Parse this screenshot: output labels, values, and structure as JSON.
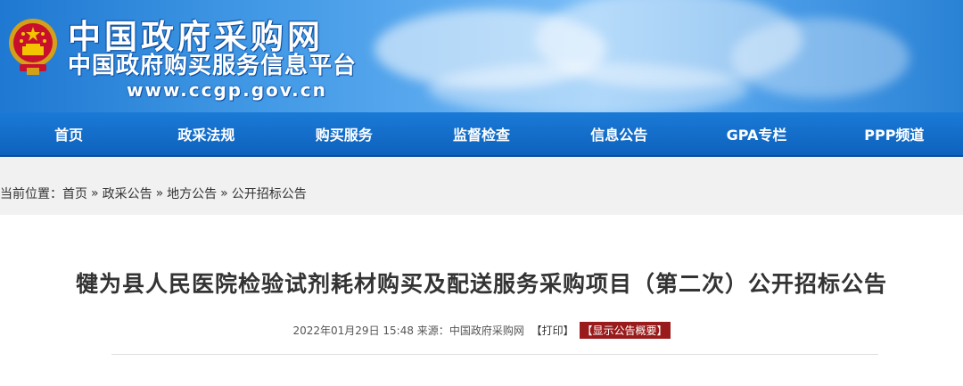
{
  "header": {
    "title": "中国政府采购网",
    "subtitle": "中国政府购买服务信息平台",
    "url": "www.ccgp.gov.cn",
    "emblem_icon": "national-emblem-icon"
  },
  "nav": {
    "items": [
      {
        "label": "首页"
      },
      {
        "label": "政采法规"
      },
      {
        "label": "购买服务"
      },
      {
        "label": "监督检查"
      },
      {
        "label": "信息公告"
      },
      {
        "label": "GPA专栏"
      },
      {
        "label": "PPP频道"
      }
    ]
  },
  "breadcrumb": {
    "prefix": "当前位置：",
    "items": [
      {
        "label": "首页"
      },
      {
        "label": "政采公告"
      },
      {
        "label": "地方公告"
      },
      {
        "label": "公开招标公告"
      }
    ],
    "separator": "»"
  },
  "article": {
    "title": "犍为县人民医院检验试剂耗材购买及配送服务采购项目（第二次）公开招标公告",
    "date": "2022年01月29日 15:48",
    "source_label": "来源：",
    "source": "中国政府采购网",
    "print": "【打印】",
    "summary": "【显示公告概要】"
  },
  "colors": {
    "nav_bg": "#0e62bd",
    "summary_bg": "#9a1b1b",
    "header_bg": "#3f97e4"
  }
}
